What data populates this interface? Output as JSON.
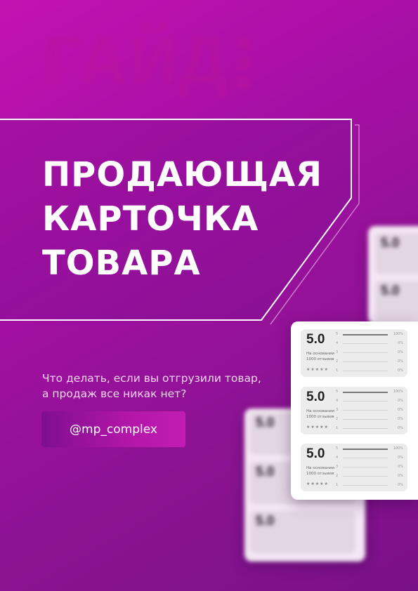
{
  "background_word": "ГАЙД",
  "title_lines": [
    "ПРОДАЮЩАЯ",
    "КАРТОЧКА",
    "ТОВАРА"
  ],
  "subtitle_lines": [
    "Что делать, если вы отгрузили товар,",
    "а продаж все никак нет?"
  ],
  "handle": "@mp_complex",
  "review_cards": [
    {
      "score": "5.0",
      "note_lines": [
        "На основании",
        "1000 отзывов"
      ],
      "stars": "★★★★★",
      "rows": [
        {
          "n": "5",
          "p": "100%",
          "fill": 1
        },
        {
          "n": "4",
          "p": "0%",
          "fill": 0
        },
        {
          "n": "3",
          "p": "0%",
          "fill": 0
        },
        {
          "n": "2",
          "p": "0%",
          "fill": 0
        },
        {
          "n": "1",
          "p": "0%",
          "fill": 0
        }
      ]
    }
  ],
  "colors": {
    "accent": "#c313b0",
    "title": "#ffffff"
  }
}
